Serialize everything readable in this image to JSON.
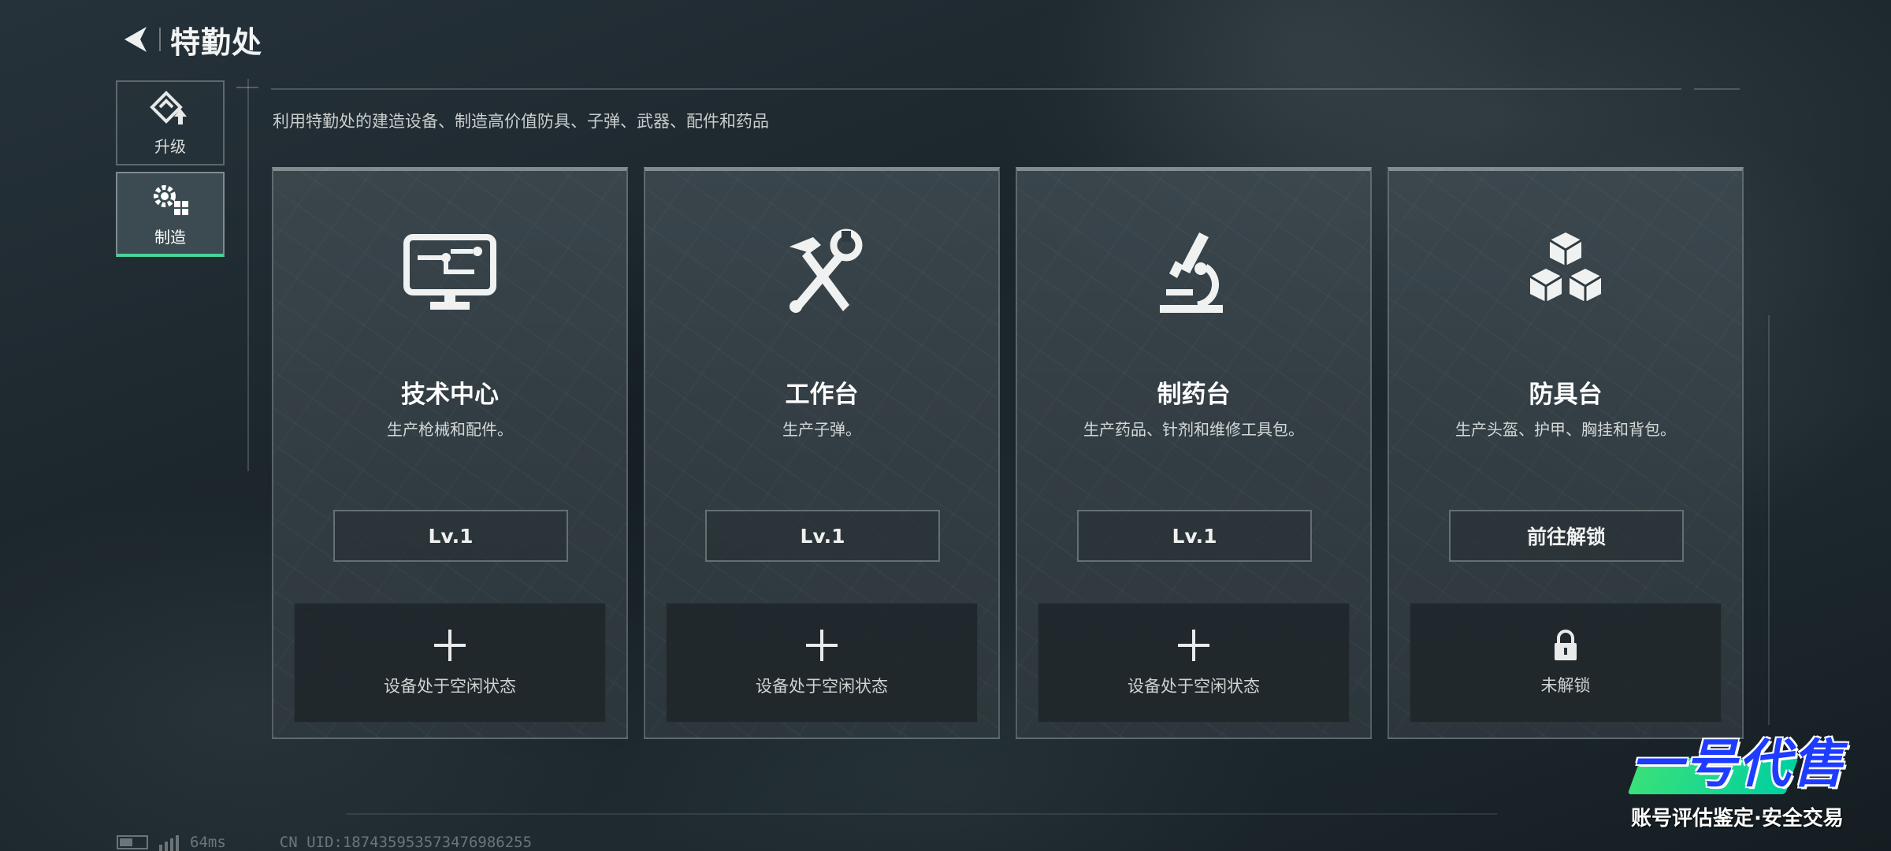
{
  "header": {
    "title": "特勤处"
  },
  "sidebar": {
    "items": [
      {
        "label": "升级",
        "icon": "upgrade-icon",
        "active": false
      },
      {
        "label": "制造",
        "icon": "craft-gear-icon",
        "active": true
      }
    ]
  },
  "subtitle": "利用特勤处的建造设备、制造高价值防具、子弹、武器、配件和药品",
  "cards": [
    {
      "title": "技术中心",
      "desc": "生产枪械和配件。",
      "button": "Lv.1",
      "slot_label": "设备处于空闲状态",
      "icon": "computer-icon",
      "slot_icon": "plus-icon"
    },
    {
      "title": "工作台",
      "desc": "生产子弹。",
      "button": "Lv.1",
      "slot_label": "设备处于空闲状态",
      "icon": "hammer-wrench-icon",
      "slot_icon": "plus-icon"
    },
    {
      "title": "制药台",
      "desc": "生产药品、针剂和维修工具包。",
      "button": "Lv.1",
      "slot_label": "设备处于空闲状态",
      "icon": "microscope-icon",
      "slot_icon": "plus-icon"
    },
    {
      "title": "防具台",
      "desc": "生产头盔、护甲、胸挂和背包。",
      "button": "前往解锁",
      "slot_label": "未解锁",
      "icon": "cubes-icon",
      "slot_icon": "lock-icon"
    }
  ],
  "footer": {
    "ping": "64ms",
    "uid": "CN UID:187435953573476986255"
  },
  "watermark": {
    "logo": "一号代售",
    "tagline": "账号评估鉴定·安全交易"
  },
  "colors": {
    "accent": "#49d29a",
    "background": "#1e2a30"
  }
}
